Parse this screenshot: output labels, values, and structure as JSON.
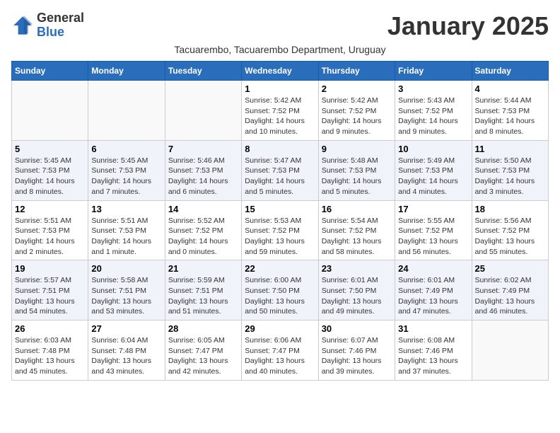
{
  "header": {
    "logo_general": "General",
    "logo_blue": "Blue",
    "month_title": "January 2025",
    "subtitle": "Tacuarembo, Tacuarembo Department, Uruguay"
  },
  "weekdays": [
    "Sunday",
    "Monday",
    "Tuesday",
    "Wednesday",
    "Thursday",
    "Friday",
    "Saturday"
  ],
  "weeks": [
    [
      {
        "day": "",
        "info": ""
      },
      {
        "day": "",
        "info": ""
      },
      {
        "day": "",
        "info": ""
      },
      {
        "day": "1",
        "info": "Sunrise: 5:42 AM\nSunset: 7:52 PM\nDaylight: 14 hours\nand 10 minutes."
      },
      {
        "day": "2",
        "info": "Sunrise: 5:42 AM\nSunset: 7:52 PM\nDaylight: 14 hours\nand 9 minutes."
      },
      {
        "day": "3",
        "info": "Sunrise: 5:43 AM\nSunset: 7:52 PM\nDaylight: 14 hours\nand 9 minutes."
      },
      {
        "day": "4",
        "info": "Sunrise: 5:44 AM\nSunset: 7:53 PM\nDaylight: 14 hours\nand 8 minutes."
      }
    ],
    [
      {
        "day": "5",
        "info": "Sunrise: 5:45 AM\nSunset: 7:53 PM\nDaylight: 14 hours\nand 8 minutes."
      },
      {
        "day": "6",
        "info": "Sunrise: 5:45 AM\nSunset: 7:53 PM\nDaylight: 14 hours\nand 7 minutes."
      },
      {
        "day": "7",
        "info": "Sunrise: 5:46 AM\nSunset: 7:53 PM\nDaylight: 14 hours\nand 6 minutes."
      },
      {
        "day": "8",
        "info": "Sunrise: 5:47 AM\nSunset: 7:53 PM\nDaylight: 14 hours\nand 5 minutes."
      },
      {
        "day": "9",
        "info": "Sunrise: 5:48 AM\nSunset: 7:53 PM\nDaylight: 14 hours\nand 5 minutes."
      },
      {
        "day": "10",
        "info": "Sunrise: 5:49 AM\nSunset: 7:53 PM\nDaylight: 14 hours\nand 4 minutes."
      },
      {
        "day": "11",
        "info": "Sunrise: 5:50 AM\nSunset: 7:53 PM\nDaylight: 14 hours\nand 3 minutes."
      }
    ],
    [
      {
        "day": "12",
        "info": "Sunrise: 5:51 AM\nSunset: 7:53 PM\nDaylight: 14 hours\nand 2 minutes."
      },
      {
        "day": "13",
        "info": "Sunrise: 5:51 AM\nSunset: 7:53 PM\nDaylight: 14 hours\nand 1 minute."
      },
      {
        "day": "14",
        "info": "Sunrise: 5:52 AM\nSunset: 7:52 PM\nDaylight: 14 hours\nand 0 minutes."
      },
      {
        "day": "15",
        "info": "Sunrise: 5:53 AM\nSunset: 7:52 PM\nDaylight: 13 hours\nand 59 minutes."
      },
      {
        "day": "16",
        "info": "Sunrise: 5:54 AM\nSunset: 7:52 PM\nDaylight: 13 hours\nand 58 minutes."
      },
      {
        "day": "17",
        "info": "Sunrise: 5:55 AM\nSunset: 7:52 PM\nDaylight: 13 hours\nand 56 minutes."
      },
      {
        "day": "18",
        "info": "Sunrise: 5:56 AM\nSunset: 7:52 PM\nDaylight: 13 hours\nand 55 minutes."
      }
    ],
    [
      {
        "day": "19",
        "info": "Sunrise: 5:57 AM\nSunset: 7:51 PM\nDaylight: 13 hours\nand 54 minutes."
      },
      {
        "day": "20",
        "info": "Sunrise: 5:58 AM\nSunset: 7:51 PM\nDaylight: 13 hours\nand 53 minutes."
      },
      {
        "day": "21",
        "info": "Sunrise: 5:59 AM\nSunset: 7:51 PM\nDaylight: 13 hours\nand 51 minutes."
      },
      {
        "day": "22",
        "info": "Sunrise: 6:00 AM\nSunset: 7:50 PM\nDaylight: 13 hours\nand 50 minutes."
      },
      {
        "day": "23",
        "info": "Sunrise: 6:01 AM\nSunset: 7:50 PM\nDaylight: 13 hours\nand 49 minutes."
      },
      {
        "day": "24",
        "info": "Sunrise: 6:01 AM\nSunset: 7:49 PM\nDaylight: 13 hours\nand 47 minutes."
      },
      {
        "day": "25",
        "info": "Sunrise: 6:02 AM\nSunset: 7:49 PM\nDaylight: 13 hours\nand 46 minutes."
      }
    ],
    [
      {
        "day": "26",
        "info": "Sunrise: 6:03 AM\nSunset: 7:48 PM\nDaylight: 13 hours\nand 45 minutes."
      },
      {
        "day": "27",
        "info": "Sunrise: 6:04 AM\nSunset: 7:48 PM\nDaylight: 13 hours\nand 43 minutes."
      },
      {
        "day": "28",
        "info": "Sunrise: 6:05 AM\nSunset: 7:47 PM\nDaylight: 13 hours\nand 42 minutes."
      },
      {
        "day": "29",
        "info": "Sunrise: 6:06 AM\nSunset: 7:47 PM\nDaylight: 13 hours\nand 40 minutes."
      },
      {
        "day": "30",
        "info": "Sunrise: 6:07 AM\nSunset: 7:46 PM\nDaylight: 13 hours\nand 39 minutes."
      },
      {
        "day": "31",
        "info": "Sunrise: 6:08 AM\nSunset: 7:46 PM\nDaylight: 13 hours\nand 37 minutes."
      },
      {
        "day": "",
        "info": ""
      }
    ]
  ]
}
